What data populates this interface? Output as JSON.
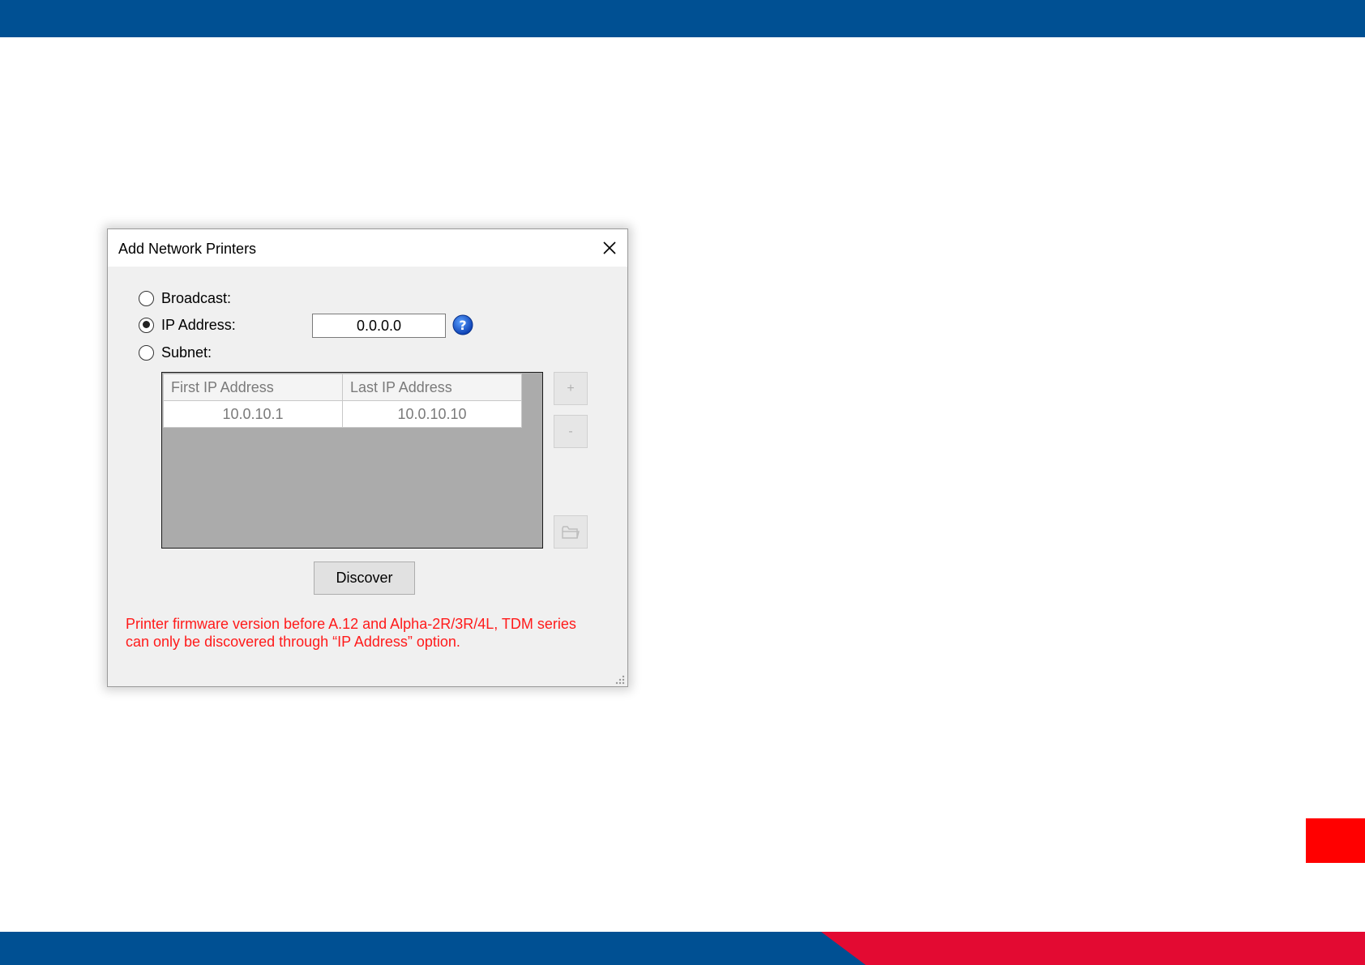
{
  "colors": {
    "brand_blue": "#005093",
    "brand_red": "#e30a32",
    "marker_red": "#ff0000",
    "warning_red": "#ff1a1a"
  },
  "dialog": {
    "title": "Add Network Printers",
    "options": {
      "broadcast": {
        "label": "Broadcast:",
        "checked": false
      },
      "ip_address": {
        "label": "IP Address:",
        "checked": true
      },
      "subnet": {
        "label": "Subnet:",
        "checked": false
      }
    },
    "ip_value": "0.0.0.0",
    "subnet_table": {
      "columns": [
        "First IP Address",
        "Last IP Address"
      ],
      "rows": [
        [
          "10.0.10.1",
          "10.0.10.10"
        ]
      ]
    },
    "side_buttons": {
      "add": "+",
      "remove": "-"
    },
    "discover_label": "Discover",
    "warning_lines": [
      "Printer firmware version before A.12 and Alpha-2R/3R/4L, TDM series",
      "can only be discovered through “IP Address” option."
    ]
  }
}
